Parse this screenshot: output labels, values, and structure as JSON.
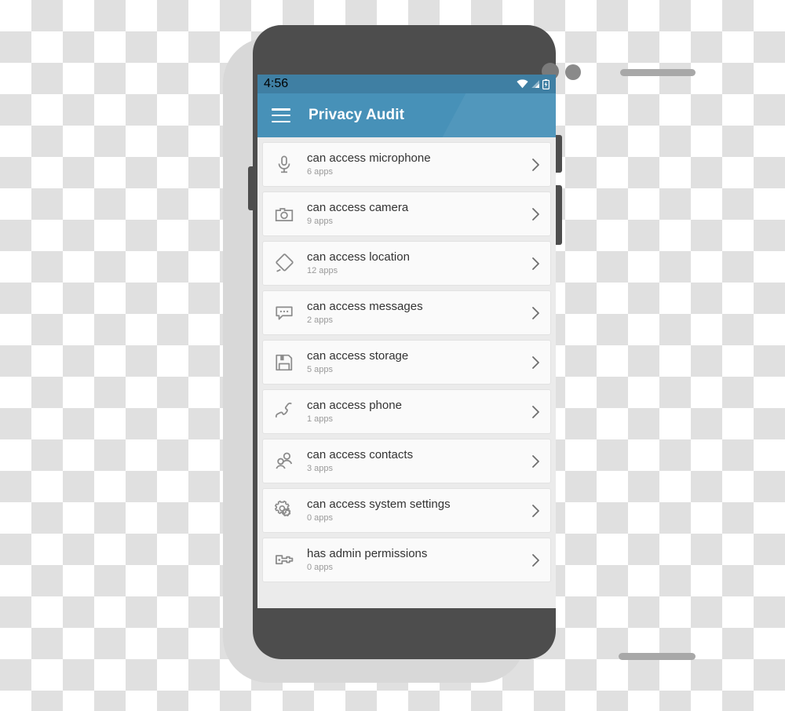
{
  "device": {
    "frame_color": "#4d4d4d",
    "shadow_color": "#d8d8d8"
  },
  "status_bar": {
    "time": "4:56",
    "background": "#3f7fa3",
    "icons": [
      "wifi-icon",
      "signal-icon",
      "battery-charging-icon"
    ]
  },
  "app_bar": {
    "title": "Privacy Audit",
    "menu_label": "Menu",
    "background": "#4791b8"
  },
  "list": {
    "items": [
      {
        "icon": "microphone-icon",
        "title": "can access microphone",
        "subtitle": "6 apps",
        "count": 6
      },
      {
        "icon": "camera-icon",
        "title": "can access camera",
        "subtitle": "9 apps",
        "count": 9
      },
      {
        "icon": "location-icon",
        "title": "can access location",
        "subtitle": "12 apps",
        "count": 12
      },
      {
        "icon": "messages-icon",
        "title": "can access messages",
        "subtitle": "2 apps",
        "count": 2
      },
      {
        "icon": "storage-icon",
        "title": "can access storage",
        "subtitle": "5 apps",
        "count": 5
      },
      {
        "icon": "phone-icon",
        "title": "can access phone",
        "subtitle": "1 apps",
        "count": 1
      },
      {
        "icon": "contacts-icon",
        "title": "can access contacts",
        "subtitle": "3 apps",
        "count": 3
      },
      {
        "icon": "settings-icon",
        "title": "can access system settings",
        "subtitle": "0 apps",
        "count": 0
      },
      {
        "icon": "key-icon",
        "title": "has admin permissions",
        "subtitle": "0 apps",
        "count": 0
      }
    ],
    "chevron_icon": "chevron-right-icon"
  }
}
